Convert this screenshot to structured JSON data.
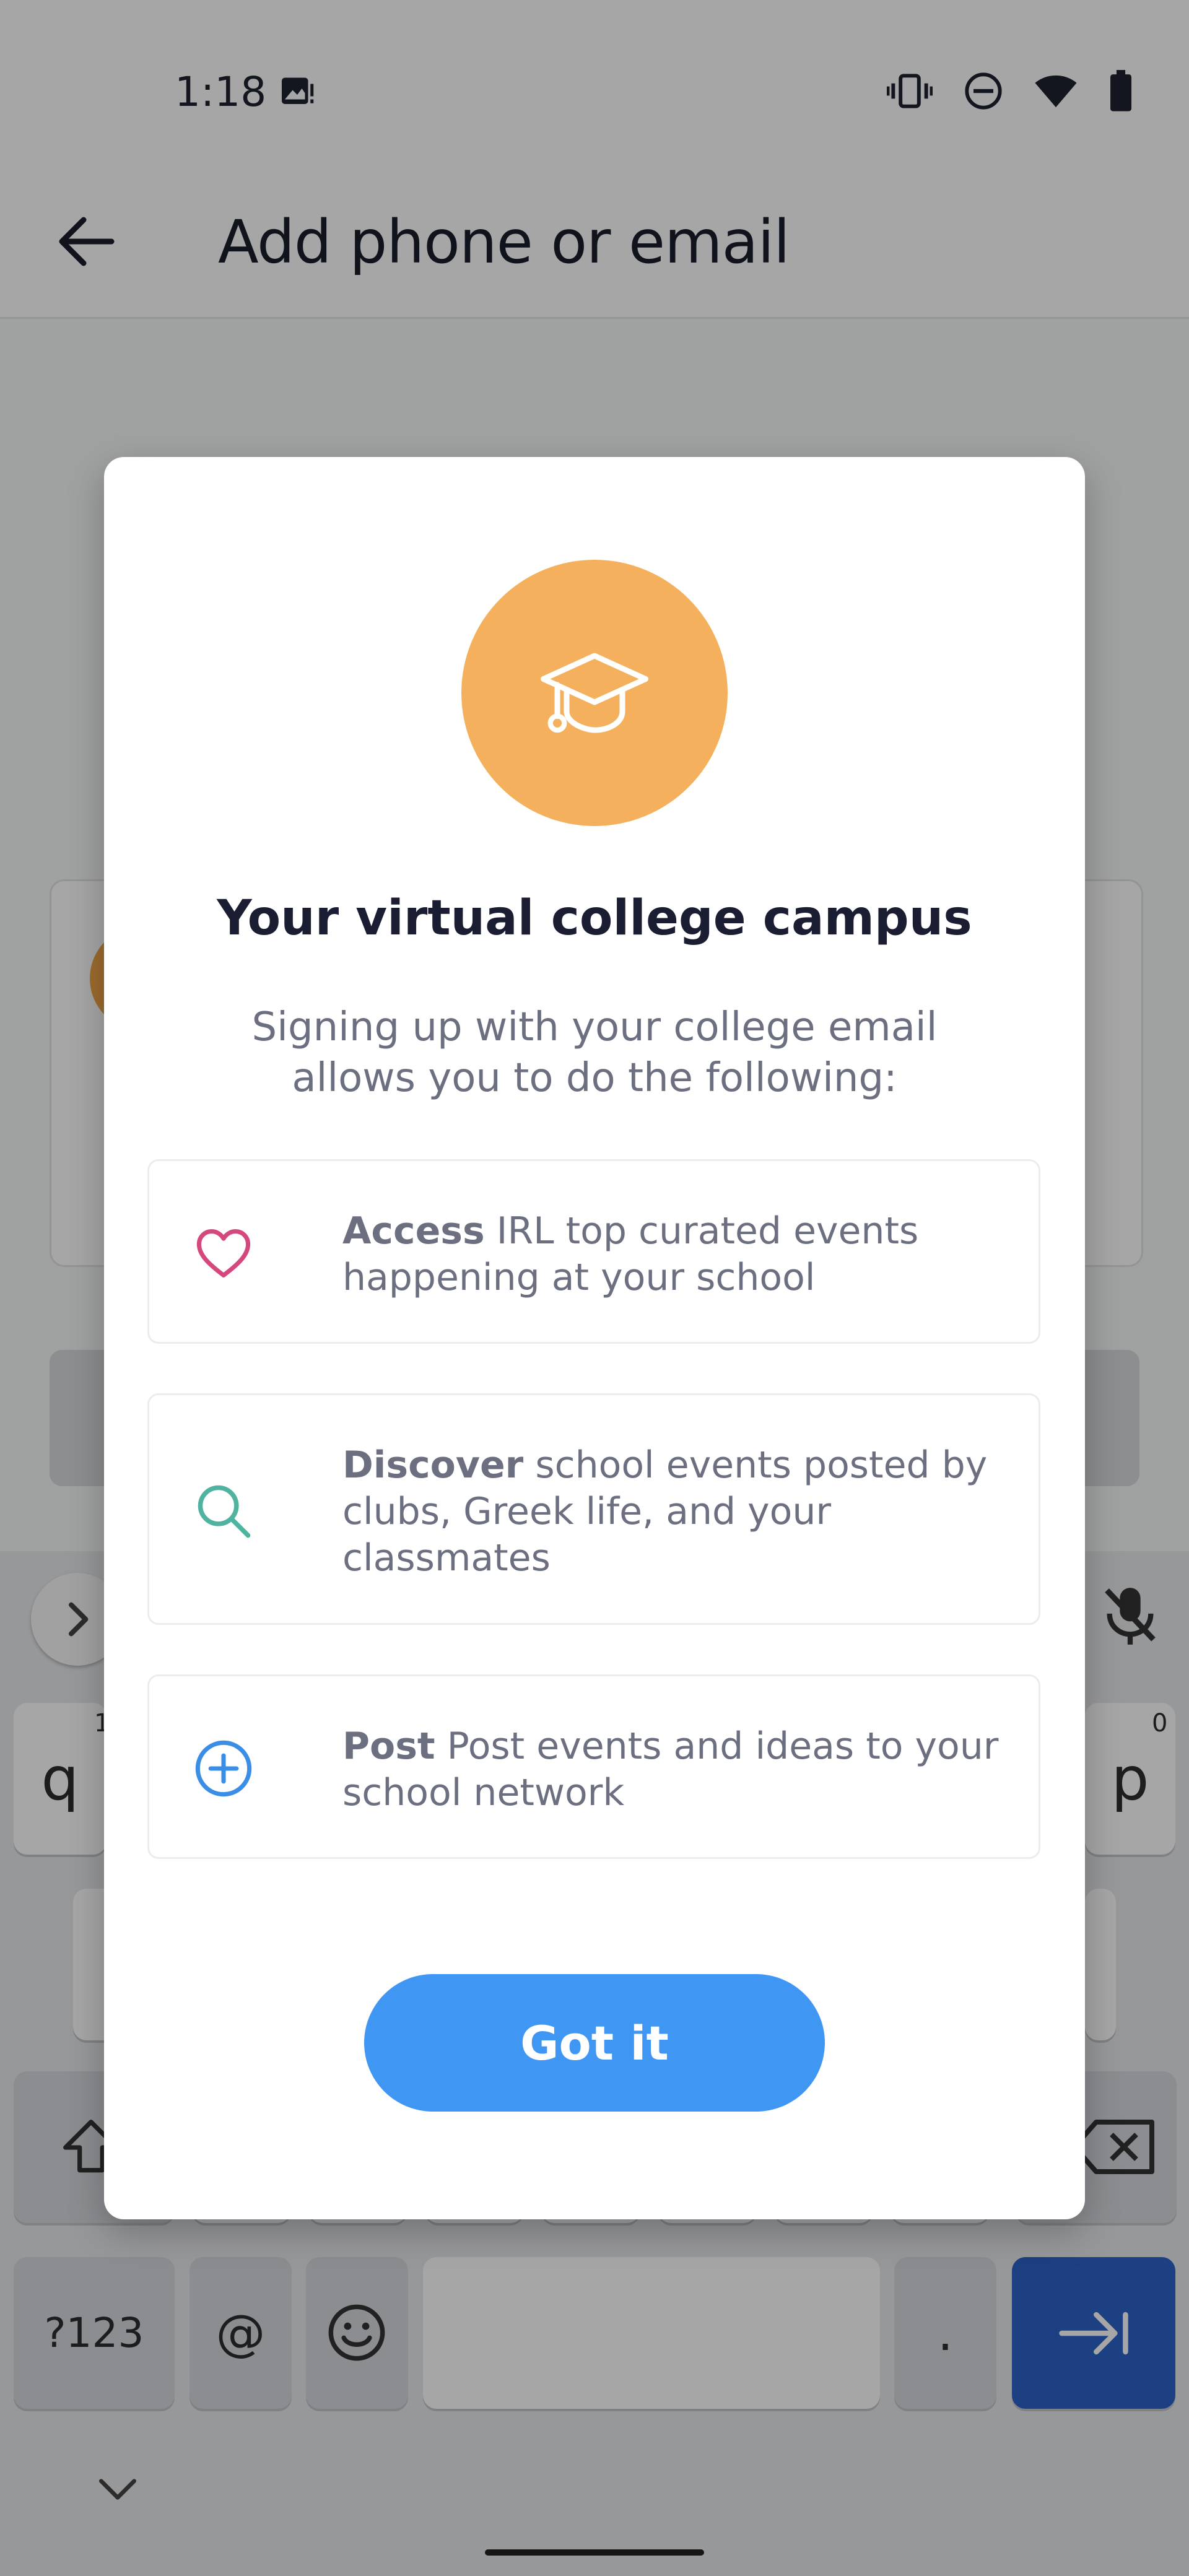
{
  "status_bar": {
    "time": "1:18",
    "icons": [
      "photo-icon",
      "vibrate-icon",
      "do-not-disturb-icon",
      "wifi-icon",
      "battery-icon"
    ]
  },
  "app_bar": {
    "title": "Add phone or email",
    "back_icon": "arrow-left-icon"
  },
  "keyboard": {
    "row1_left_key": "q",
    "row1_left_hint": "1",
    "row1_right_key": "p",
    "row1_right_hint": "0",
    "symbols_key": "?123",
    "at_key": "@",
    "period_key": ".",
    "enter_icon": "tab-arrow-icon"
  },
  "dialog": {
    "icon": "graduation-cap-icon",
    "title": "Your virtual college campus",
    "subtitle": "Signing up with your college email allows you to do the following:",
    "features": [
      {
        "icon": "heart-icon",
        "bold": "Access",
        "text": " IRL top curated events happening at your school"
      },
      {
        "icon": "search-icon",
        "bold": "Discover",
        "text": " school events posted by clubs, Greek life, and your classmates"
      },
      {
        "icon": "plus-circle-icon",
        "bold": "Post",
        "text": " Post events and ideas to your school network"
      }
    ],
    "button_label": "Got it"
  },
  "colors": {
    "accent_blue": "#4096f3",
    "hero_orange": "#f4b05c",
    "heart_pink": "#d4487e",
    "search_green": "#4fb3a0",
    "plus_blue": "#3a8ee6"
  }
}
